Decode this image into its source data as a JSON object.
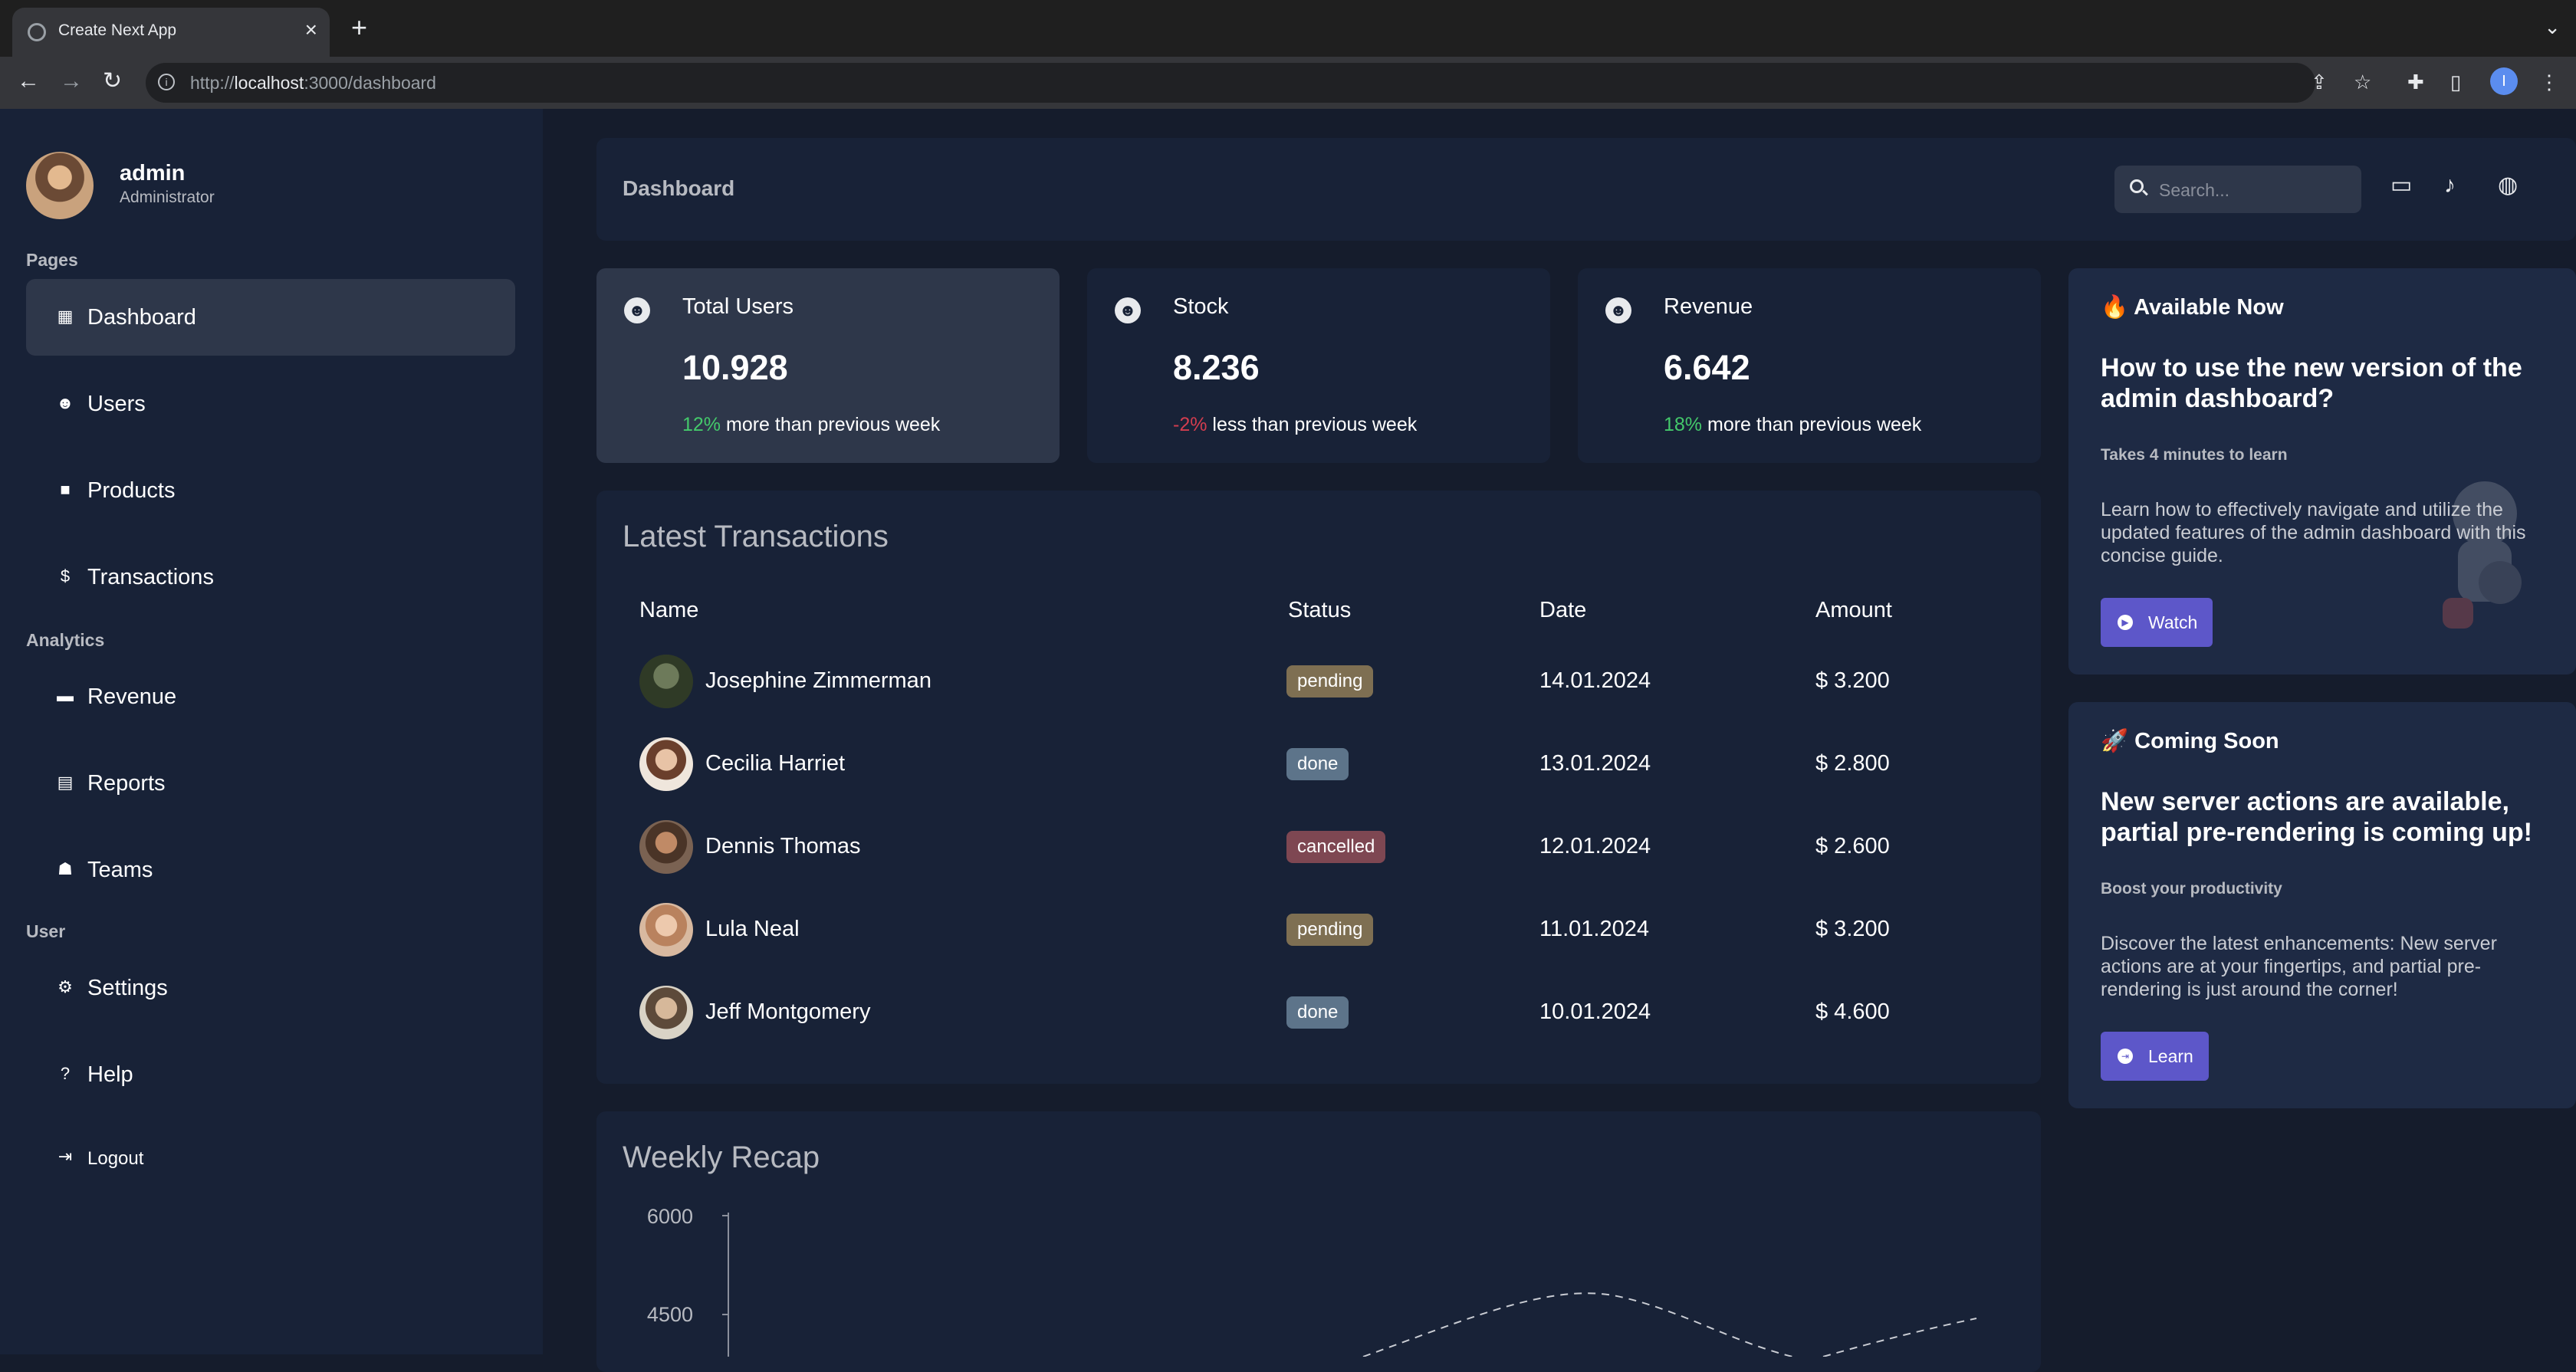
{
  "browser": {
    "tab_title": "Create Next App",
    "url_prefix": "http://",
    "url_host": "localhost",
    "url_rest": ":3000/dashboard",
    "profile_initial": "I"
  },
  "sidebar": {
    "user": {
      "name": "admin",
      "role": "Administrator"
    },
    "sections": [
      {
        "title": "Pages",
        "items": [
          {
            "label": "Dashboard",
            "icon": "dashboard-icon",
            "active": true
          },
          {
            "label": "Users",
            "icon": "users-icon"
          },
          {
            "label": "Products",
            "icon": "shopping-bag-icon"
          },
          {
            "label": "Transactions",
            "icon": "dollar-icon"
          }
        ]
      },
      {
        "title": "Analytics",
        "items": [
          {
            "label": "Revenue",
            "icon": "briefcase-icon"
          },
          {
            "label": "Reports",
            "icon": "report-icon"
          },
          {
            "label": "Teams",
            "icon": "team-icon"
          }
        ]
      },
      {
        "title": "User",
        "items": [
          {
            "label": "Settings",
            "icon": "gear-icon"
          },
          {
            "label": "Help",
            "icon": "help-icon"
          }
        ]
      }
    ],
    "logout_label": "Logout"
  },
  "header": {
    "title": "Dashboard",
    "search_placeholder": "Search..."
  },
  "cards": [
    {
      "title": "Total Users",
      "number": "10.928",
      "change": "12%",
      "change_text": " more than previous week",
      "trend": "positive"
    },
    {
      "title": "Stock",
      "number": "8.236",
      "change": "-2%",
      "change_text": " less than previous week",
      "trend": "negative"
    },
    {
      "title": "Revenue",
      "number": "6.642",
      "change": "18%",
      "change_text": " more than previous week",
      "trend": "positive"
    }
  ],
  "transactions": {
    "title": "Latest Transactions",
    "columns": [
      "Name",
      "Status",
      "Date",
      "Amount"
    ],
    "rows": [
      {
        "name": "Josephine Zimmerman",
        "status": "pending",
        "date": "14.01.2024",
        "amount": "$ 3.200"
      },
      {
        "name": "Cecilia Harriet",
        "status": "done",
        "date": "13.01.2024",
        "amount": "$ 2.800"
      },
      {
        "name": "Dennis Thomas",
        "status": "cancelled",
        "date": "12.01.2024",
        "amount": "$ 2.600"
      },
      {
        "name": "Lula Neal",
        "status": "pending",
        "date": "11.01.2024",
        "amount": "$ 3.200"
      },
      {
        "name": "Jeff Montgomery",
        "status": "done",
        "date": "10.01.2024",
        "amount": "$ 4.600"
      }
    ]
  },
  "chart": {
    "title": "Weekly Recap",
    "y_ticks": [
      "6000",
      "4500"
    ]
  },
  "promos": [
    {
      "head": "🔥 Available Now",
      "title": "How to use the new version of the admin dashboard?",
      "subtitle": "Takes 4 minutes to learn",
      "description": "Learn how to effectively navigate and utilize the updated features of the admin dashboard with this concise guide.",
      "button": "Watch"
    },
    {
      "head": "🚀 Coming Soon",
      "title": "New server actions are available, partial pre-rendering is coming up!",
      "subtitle": "Boost your productivity",
      "description": "Discover the latest enhancements: New server actions are at your fingertips, and partial pre-rendering is just around the corner!",
      "button": "Learn"
    }
  ],
  "colors": {
    "background": "#151c2c",
    "panel": "#182237",
    "active": "#2e374a",
    "positive": "#44c96b",
    "negative": "#d33d4f",
    "button": "#5d57c9"
  }
}
